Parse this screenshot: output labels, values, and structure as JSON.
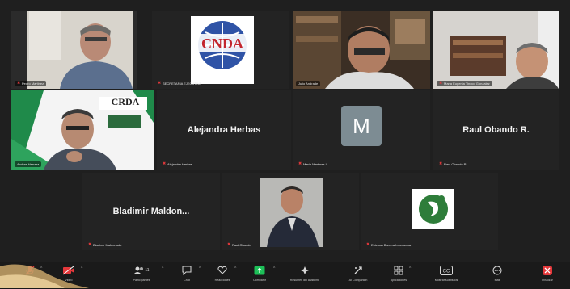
{
  "participants": [
    {
      "id": "p1",
      "tag": "Pedro Martinez",
      "muted": true
    },
    {
      "id": "p2",
      "tag": "SECRETARIA EJECUTIVA",
      "muted": true,
      "logo_text": "CNDA"
    },
    {
      "id": "p3",
      "tag": "Julio Andrade",
      "muted": false
    },
    {
      "id": "p4",
      "tag": "Maria Eugenia Tinoco Gonzalez",
      "muted": true
    },
    {
      "id": "p5",
      "tag": "Andres Herrera",
      "muted": false,
      "logo_text": "CRDA",
      "active": true
    },
    {
      "id": "p6",
      "display_name": "Alejandra Herbas",
      "tag": "Alejandra Herbas",
      "muted": true
    },
    {
      "id": "p7",
      "avatar_letter": "M",
      "tag": "Maria Martinez L.",
      "muted": true
    },
    {
      "id": "p8",
      "display_name": "Raul Obando R.",
      "tag": "Raul Obando R.",
      "muted": true
    },
    {
      "id": "p9",
      "display_name": "Bladimir Maldon...",
      "tag": "Bladimir Maldonado",
      "muted": true
    },
    {
      "id": "p10",
      "tag": "Raul Obando",
      "muted": true
    },
    {
      "id": "p11",
      "tag": "Esteban Barrera Lorenzana",
      "muted": true
    }
  ],
  "toolbar": {
    "audio": "Audio",
    "video": "Video",
    "participants": "Participantes",
    "participants_count": "11",
    "chat": "Chat",
    "reactions": "Reacciones",
    "share": "Compartir",
    "summary": "Resumen del asistente",
    "ai_companion": "AI Companion",
    "apps": "Aplicaciones",
    "captions": "Mostrar subtítulos",
    "more": "Más",
    "leave": "Finalizar"
  },
  "colors": {
    "active_speaker": "#2fb55a",
    "share_green": "#1dc058",
    "muted_red": "#e5383b",
    "avatar_gray": "#7d8c93"
  }
}
